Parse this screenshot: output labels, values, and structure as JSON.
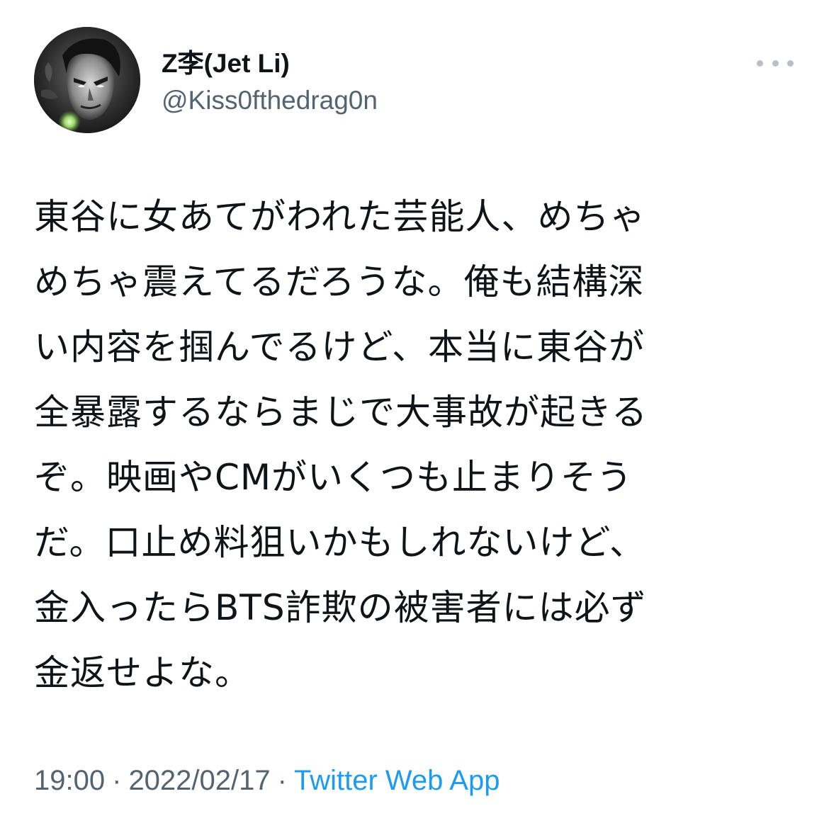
{
  "author": {
    "display_name": "Z李(Jet Li)",
    "handle": "@Kiss0fthedrag0n",
    "avatar_icon": "profile-photo-avatar"
  },
  "menu": {
    "icon": "more-options-icon"
  },
  "tweet": {
    "lines": [
      "東谷に女あてがわれた芸能人、めちゃ",
      "めちゃ震えてるだろうな。俺も結構深",
      "い内容を掴んでるけど、本当に東谷が",
      "全暴露するならまじで大事故が起きる",
      "ぞ。映画やCMがいくつも止まりそう",
      "だ。口止め料狙いかもしれないけど、",
      "金入ったらBTS詐欺の被害者には必ず",
      "金返せよな。"
    ]
  },
  "meta": {
    "time": "19:00",
    "separator": "·",
    "date": "2022/02/17",
    "source": "Twitter Web App"
  },
  "colors": {
    "text": "#0f1419",
    "secondary": "#536471",
    "link": "#1d9bf0"
  }
}
